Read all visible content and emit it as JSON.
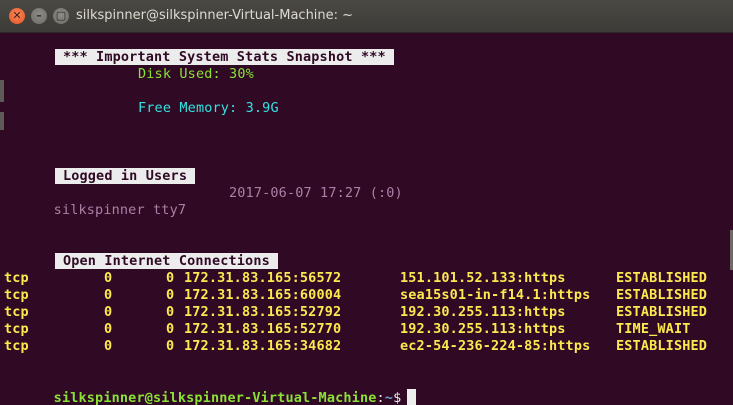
{
  "window": {
    "title": "silkspinner@silkspinner-Virtual-Machine: ~"
  },
  "stats": {
    "header": " *** Important System Stats Snapshot *** ",
    "disk_used": "Disk Used: 30%",
    "free_memory": "Free Memory: 3.9G"
  },
  "users": {
    "header": " Logged in Users ",
    "rows": [
      {
        "user": "silkspinner",
        "tty": "tty7",
        "time": "2017-06-07 17:27 (:0)"
      }
    ]
  },
  "connections": {
    "header": " Open Internet Connections ",
    "rows": [
      {
        "proto": "tcp",
        "recv_q": "0",
        "send_q": "0",
        "local": "172.31.83.165:56572",
        "foreign": "151.101.52.133:https",
        "state": "ESTABLISHED"
      },
      {
        "proto": "tcp",
        "recv_q": "0",
        "send_q": "0",
        "local": "172.31.83.165:60004",
        "foreign": "sea15s01-in-f14.1:https",
        "state": "ESTABLISHED"
      },
      {
        "proto": "tcp",
        "recv_q": "0",
        "send_q": "0",
        "local": "172.31.83.165:52792",
        "foreign": "192.30.255.113:https",
        "state": "ESTABLISHED"
      },
      {
        "proto": "tcp",
        "recv_q": "0",
        "send_q": "0",
        "local": "172.31.83.165:52770",
        "foreign": "192.30.255.113:https",
        "state": "TIME_WAIT"
      },
      {
        "proto": "tcp",
        "recv_q": "0",
        "send_q": "0",
        "local": "172.31.83.165:34682",
        "foreign": "ec2-54-236-224-85:https",
        "state": "ESTABLISHED"
      }
    ]
  },
  "prompt": {
    "user_host": "silkspinner@silkspinner-Virtual-Machine",
    "colon": ":",
    "path": "~",
    "symbol": "$"
  },
  "colors": {
    "terminal_bg": "#300a24",
    "green": "#8ae234",
    "cyan": "#34e2e2",
    "yellow": "#fce94f",
    "user_text": "#ad7fa8",
    "path_blue": "#729fcf",
    "close_button": "#e9541f"
  },
  "icons": {
    "close": "close-icon",
    "minimize": "minimize-icon",
    "maximize": "maximize-icon"
  }
}
